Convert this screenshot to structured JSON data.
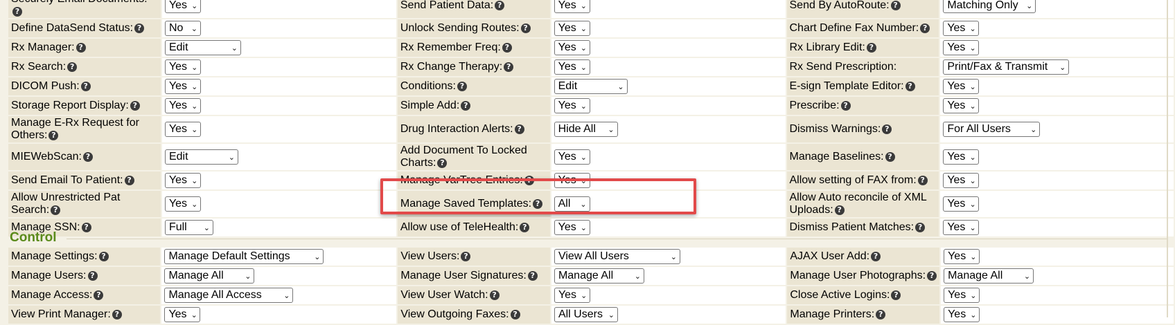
{
  "permissions_rows": [
    {
      "c1": {
        "label": "Securely Email Documents:",
        "value": "Yes"
      },
      "c2": {
        "label": "Send Patient Data:",
        "value": "Yes"
      },
      "c3": {
        "label": "Send By AutoRoute:",
        "value": "Matching Only"
      }
    },
    {
      "c1": {
        "label": "Define DataSend Status:",
        "value": "No"
      },
      "c2": {
        "label": "Unlock Sending Routes:",
        "value": "Yes"
      },
      "c3": {
        "label": "Chart Define Fax Number:",
        "value": "Yes"
      }
    },
    {
      "c1": {
        "label": "Rx Manager:",
        "value": "Edit"
      },
      "c2": {
        "label": "Rx Remember Freq:",
        "value": "Yes"
      },
      "c3": {
        "label": "Rx Library Edit:",
        "value": "Yes"
      }
    },
    {
      "c1": {
        "label": "Rx Search:",
        "value": "Yes"
      },
      "c2": {
        "label": "Rx Change Therapy:",
        "value": "Yes"
      },
      "c3": {
        "label": "Rx Send Prescription:",
        "value": "Print/Fax & Transmit"
      }
    },
    {
      "c1": {
        "label": "DICOM Push:",
        "value": "Yes"
      },
      "c2": {
        "label": "Conditions:",
        "value": "Edit"
      },
      "c3": {
        "label": "E-sign Template Editor:",
        "value": "Yes"
      }
    },
    {
      "c1": {
        "label": "Storage Report Display:",
        "value": "Yes"
      },
      "c2": {
        "label": "Simple Add:",
        "value": "Yes"
      },
      "c3": {
        "label": "Prescribe:",
        "value": "Yes"
      }
    },
    {
      "c1": {
        "label": "Manage E-Rx Request for Others:",
        "value": "Yes"
      },
      "c2": {
        "label": "Drug Interaction Alerts:",
        "value": "Hide All"
      },
      "c3": {
        "label": "Dismiss Warnings:",
        "value": "For All Users"
      }
    },
    {
      "c1": {
        "label": "MIEWebScan:",
        "value": "Edit"
      },
      "c2": {
        "label": "Add Document To Locked Charts:",
        "value": "Yes"
      },
      "c3": {
        "label": "Manage Baselines:",
        "value": "Yes"
      }
    },
    {
      "c1": {
        "label": "Send Email To Patient:",
        "value": "Yes"
      },
      "c2": {
        "label": "Manage VarTree Entries:",
        "value": "Yes"
      },
      "c3": {
        "label": "Allow setting of FAX from:",
        "value": "Yes"
      }
    },
    {
      "c1": {
        "label": "Allow Unrestricted Pat Search:",
        "value": "Yes"
      },
      "c2": {
        "label": "Manage Saved Templates:",
        "value": "All"
      },
      "c3": {
        "label": "Allow Auto reconcile of XML Uploads:",
        "value": "Yes"
      }
    },
    {
      "c1": {
        "label": "Manage SSN:",
        "value": "Full"
      },
      "c2": {
        "label": "Allow use of TeleHealth:",
        "value": "Yes"
      },
      "c3": {
        "label": "Dismiss Patient Matches:",
        "value": "Yes"
      }
    }
  ],
  "control_section": {
    "title": "Control",
    "rows": [
      {
        "c1": {
          "label": "Manage Settings:",
          "value": "Manage Default Settings"
        },
        "c2": {
          "label": "View Users:",
          "value": "View All Users"
        },
        "c3": {
          "label": "AJAX User Add:",
          "value": "Yes"
        }
      },
      {
        "c1": {
          "label": "Manage Users:",
          "value": "Manage All"
        },
        "c2": {
          "label": "Manage User Signatures:",
          "value": "Manage All"
        },
        "c3": {
          "label": "Manage User Photographs:",
          "value": "Manage All"
        }
      },
      {
        "c1": {
          "label": "Manage Access:",
          "value": "Manage All Access"
        },
        "c2": {
          "label": "View User Watch:",
          "value": "Yes"
        },
        "c3": {
          "label": "Close Active Logins:",
          "value": "Yes"
        }
      },
      {
        "c1": {
          "label": "View Print Manager:",
          "value": "Yes"
        },
        "c2": {
          "label": "View Outgoing Faxes:",
          "value": "All Users"
        },
        "c3": {
          "label": "Manage Printers:",
          "value": "Yes"
        }
      }
    ]
  },
  "help_icon_glyph": "?",
  "dropdown_chevron_glyph": "⌄",
  "highlight_color": "#e24a4a",
  "section_title_color": "#5a8a1a"
}
